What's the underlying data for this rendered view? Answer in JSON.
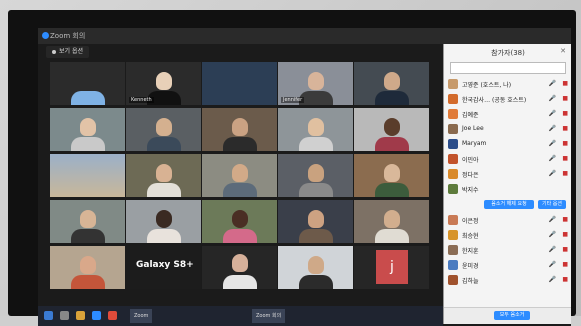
{
  "window": {
    "title": "Zoom 회의"
  },
  "view": {
    "label": "보기 옵션"
  },
  "galaxy_label": "Galaxy S8+",
  "panel": {
    "title": "참가자(38)",
    "search_placeholder": "",
    "participants": [
      {
        "name": "고영준 (호스트, 나)",
        "color": "#c79a6b"
      },
      {
        "name": "한국감사… (공동 호스트)",
        "color": "#d36b2c"
      },
      {
        "name": "김예준",
        "color": "#e07b39"
      },
      {
        "name": "Joe Lee",
        "color": "#8a6a4e"
      },
      {
        "name": "Maryam",
        "color": "#2b4d8a"
      },
      {
        "name": "이민아",
        "color": "#c2532b"
      },
      {
        "name": "정다은",
        "color": "#d98a2b"
      },
      {
        "name": "박지수",
        "color": "#5d7b3c"
      },
      {
        "name": "이은정",
        "color": "#c97a55"
      },
      {
        "name": "최승현",
        "color": "#d7942a"
      },
      {
        "name": "한지훈",
        "color": "#8b6d55"
      },
      {
        "name": "윤미경",
        "color": "#4a7bc0"
      },
      {
        "name": "김하늘",
        "color": "#a0522d"
      }
    ],
    "btn_mute": "음소거 해제 요청",
    "btn_more": "기타 옵션",
    "footer_btn": "모두 음소거"
  },
  "tiles": [
    {
      "name": "",
      "bg": "#6f9fd8"
    },
    {
      "name": "Kenneth",
      "bg": "#3b3b3b"
    },
    {
      "name": "",
      "bg": "#2c3e55"
    },
    {
      "name": "Jennifer",
      "bg": "#8a8f98"
    },
    {
      "name": "",
      "bg": "#444b52"
    },
    {
      "name": "",
      "bg": "#7c8a8c"
    },
    {
      "name": "",
      "bg": "#5a5f63"
    },
    {
      "name": "",
      "bg": "#6b5b4b"
    },
    {
      "name": "",
      "bg": "#8e9599"
    },
    {
      "name": "",
      "bg": "#b9b9b9"
    },
    {
      "name": "",
      "bg": "#9bb0c8"
    },
    {
      "name": "",
      "bg": "#6d6a55"
    },
    {
      "name": "",
      "bg": "#8c8c82"
    },
    {
      "name": "",
      "bg": "#5b5f66"
    },
    {
      "name": "",
      "bg": "#8b6c4f"
    },
    {
      "name": "",
      "bg": "#808a86"
    },
    {
      "name": "",
      "bg": "#9a9fa3"
    },
    {
      "name": "",
      "bg": "#6c7a59"
    },
    {
      "name": "",
      "bg": "#3a3f4a"
    },
    {
      "name": "",
      "bg": "#7d7165"
    },
    {
      "name": "",
      "bg": "#1c1c1c"
    },
    {
      "name": "",
      "bg": "#b5a590"
    },
    {
      "name": "",
      "bg": "#6b7e8f"
    },
    {
      "name": "",
      "bg": "#d0d4d8"
    },
    {
      "name": "",
      "bg": "#6e5348"
    },
    {
      "name": "",
      "bg": "#d9b48f"
    },
    {
      "name": "",
      "bg": "#262626"
    },
    {
      "name": "",
      "bg": "#7a6e62"
    },
    {
      "name": "",
      "bg": "#c94c4c"
    }
  ],
  "taskbar": {
    "app1": "Zoom",
    "app2": "Zoom 회의"
  }
}
